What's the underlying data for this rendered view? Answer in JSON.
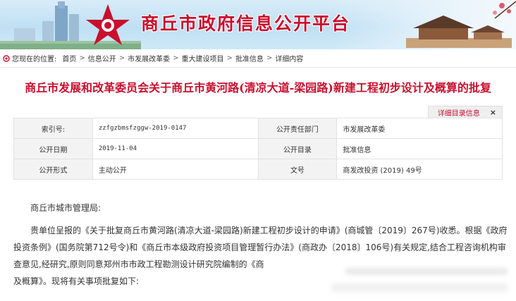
{
  "banner": {
    "title": "商丘市政府信息公开平台"
  },
  "breadcrumb": {
    "lead": "您现在的位置:",
    "items": [
      "首页",
      "信息公开",
      "市发展改革委",
      "重大建设项目",
      "批准信息",
      "详细内容"
    ]
  },
  "article": {
    "title": "商丘市发展和改革委员会关于商丘市黄河路(清凉大道-梁园路)新建工程初步设计及概算的批复"
  },
  "detail_tab": {
    "label": "详细目录信息",
    "close": "×"
  },
  "info": {
    "rows": [
      {
        "k1": "索引号:",
        "v1": "zzfgzbmsfzggw-2019-0147",
        "k2": "公开责任部门",
        "v2": "市发展改革委"
      },
      {
        "k1": "公开日期",
        "v1": "2019-11-04",
        "k2": "公开目录",
        "v2": "批准信息"
      },
      {
        "k1": "公开形式",
        "v1": "主动公开",
        "k2": "文号",
        "v2": "商发改投资 (2019) 49号"
      }
    ]
  },
  "body": {
    "greeting": "商丘市城市管理局:",
    "paragraph": "贵单位呈报的《关于批复商丘市黄河路(清凉大道-梁园路)新建工程初步设计的申请》(商城管〔2019〕267号)收悉。根据《政府投资条例》(国务院第712号令)和《商丘市本级政府投资项目管理暂行办法》(商政办〔2018〕106号)有关规定,结合工程咨询机构审查意见,经研究,原则同意郑州市市政工程勘测设计研究院编制的《商",
    "tail": "及概算》。现将有关事项批复如下:"
  },
  "colors": {
    "brand_red": "#c8102e",
    "label_bg": "#f3f3f3"
  }
}
